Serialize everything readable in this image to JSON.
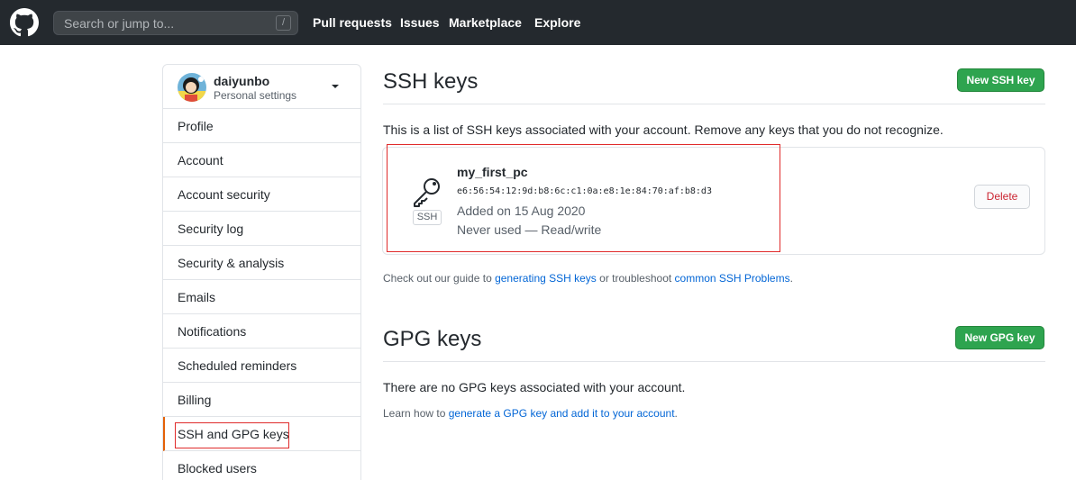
{
  "header": {
    "search_placeholder": "Search or jump to...",
    "search_shortcut": "/",
    "nav": [
      "Pull requests",
      "Issues",
      "Marketplace",
      "Explore"
    ]
  },
  "sidebar": {
    "username": "daiyunbo",
    "subtitle": "Personal settings",
    "items": [
      {
        "label": "Profile"
      },
      {
        "label": "Account"
      },
      {
        "label": "Account security"
      },
      {
        "label": "Security log"
      },
      {
        "label": "Security & analysis"
      },
      {
        "label": "Emails"
      },
      {
        "label": "Notifications"
      },
      {
        "label": "Scheduled reminders"
      },
      {
        "label": "Billing"
      },
      {
        "label": "SSH and GPG keys"
      },
      {
        "label": "Blocked users"
      }
    ],
    "selected": "SSH and GPG keys"
  },
  "ssh": {
    "title": "SSH keys",
    "new_button": "New SSH key",
    "description": "This is a list of SSH keys associated with your account. Remove any keys that you do not recognize.",
    "key": {
      "badge": "SSH",
      "name": "my_first_pc",
      "fingerprint": "e6:56:54:12:9d:b8:6c:c1:0a:e8:1e:84:70:af:b8:d3",
      "added": "Added on 15 Aug 2020",
      "usage": "Never used — Read/write",
      "delete_button": "Delete"
    },
    "guide": {
      "prefix": "Check out our guide to ",
      "link1": "generating SSH keys",
      "middle": " or troubleshoot ",
      "link2": "common SSH Problems",
      "suffix": "."
    }
  },
  "gpg": {
    "title": "GPG keys",
    "new_button": "New GPG key",
    "empty": "There are no GPG keys associated with your account.",
    "learn": {
      "prefix": "Learn how to ",
      "link": "generate a GPG key and add it to your account",
      "suffix": "."
    }
  },
  "colors": {
    "header_bg": "#24292e",
    "primary_green": "#2ea44f",
    "link_blue": "#0366d6",
    "danger_red": "#cb2431",
    "annotation_red": "#e02b2b"
  }
}
